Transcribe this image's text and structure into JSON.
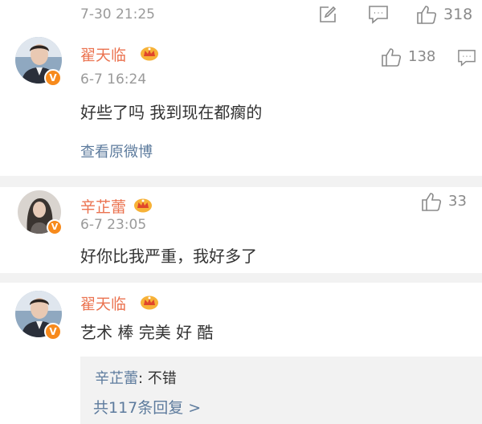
{
  "top": {
    "timestamp": "7-30 21:25",
    "like_count": "318"
  },
  "comments": [
    {
      "author": "翟天临",
      "date": "6-7 16:24",
      "text": "好些了吗 我到现在都瘸的",
      "like_count": "138",
      "view_original": "查看原微博"
    },
    {
      "author": "辛芷蕾",
      "date": "6-7 23:05",
      "text": "好你比我严重，我好多了",
      "like_count": "33"
    },
    {
      "author": "翟天临",
      "text": "艺术 棒 完美 好 酷",
      "reply": {
        "author": "辛芷蕾",
        "separator": ": ",
        "text": "不错",
        "more": "共117条回复 >"
      }
    }
  ],
  "colors": {
    "name": "#eb7350",
    "link": "#5d7b9d",
    "muted": "#9a9a9a",
    "divider": "#f2f2f2",
    "verified": "#f78a1c"
  },
  "icons": [
    "edit-icon",
    "comment-icon",
    "like-icon",
    "verified-badge-icon",
    "crown-badge-icon"
  ]
}
